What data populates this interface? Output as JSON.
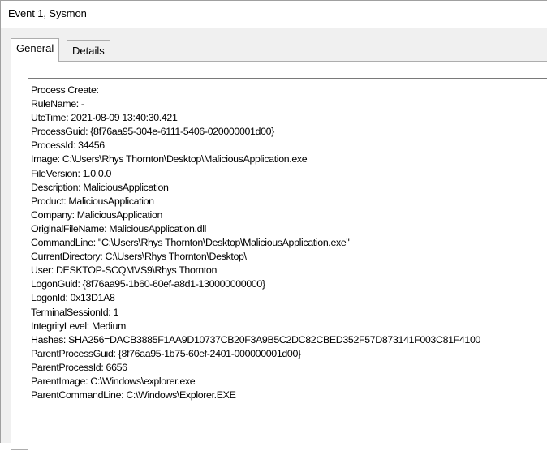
{
  "window": {
    "title": "Event 1, Sysmon"
  },
  "tabs": [
    {
      "label": "General",
      "active": true
    },
    {
      "label": "Details",
      "active": false
    }
  ],
  "details": {
    "lines": [
      "Process Create:",
      "RuleName: -",
      "UtcTime: 2021-08-09 13:40:30.421",
      "ProcessGuid: {8f76aa95-304e-6111-5406-020000001d00}",
      "ProcessId: 34456",
      "Image: C:\\Users\\Rhys Thornton\\Desktop\\MaliciousApplication.exe",
      "FileVersion: 1.0.0.0",
      "Description: MaliciousApplication",
      "Product: MaliciousApplication",
      "Company: MaliciousApplication",
      "OriginalFileName: MaliciousApplication.dll",
      "CommandLine: \"C:\\Users\\Rhys Thornton\\Desktop\\MaliciousApplication.exe\"",
      "CurrentDirectory: C:\\Users\\Rhys Thornton\\Desktop\\",
      "User: DESKTOP-SCQMVS9\\Rhys Thornton",
      "LogonGuid: {8f76aa95-1b60-60ef-a8d1-130000000000}",
      "LogonId: 0x13D1A8",
      "TerminalSessionId: 1",
      "IntegrityLevel: Medium",
      "Hashes: SHA256=DACB3885F1AA9D10737CB20F3A9B5C2DC82CBED352F57D873141F003C81F4100",
      "ParentProcessGuid: {8f76aa95-1b75-60ef-2401-000000001d00}",
      "ParentProcessId: 6656",
      "ParentImage: C:\\Windows\\explorer.exe",
      "ParentCommandLine: C:\\Windows\\Explorer.EXE"
    ]
  }
}
